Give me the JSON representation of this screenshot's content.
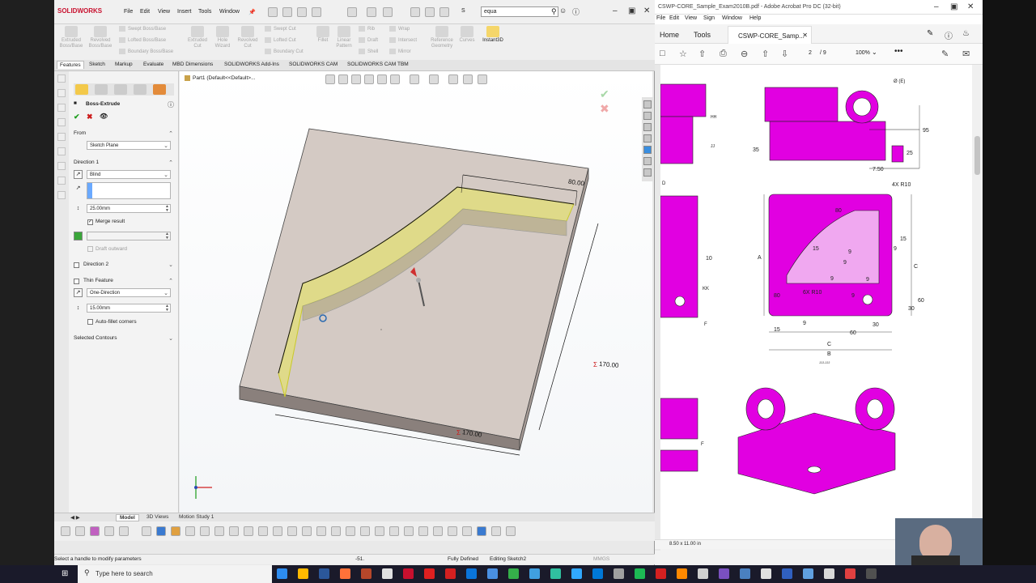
{
  "solidworks": {
    "logo": "SOLIDWORKS",
    "menu": [
      "File",
      "Edit",
      "View",
      "Insert",
      "Tools",
      "Window"
    ],
    "search_value": "equa",
    "search_label": "S",
    "ribbon": {
      "extruded_boss": "Extruded Boss/Base",
      "revolved_boss": "Revolved Boss/Base",
      "swept_boss": "Swept Boss/Base",
      "lofted_boss": "Lofted Boss/Base",
      "boundary_boss": "Boundary Boss/Base",
      "extruded_cut": "Extruded Cut",
      "hole_wizard": "Hole Wizard",
      "revolved_cut": "Revolved Cut",
      "swept_cut": "Swept Cut",
      "lofted_cut": "Lofted Cut",
      "boundary_cut": "Boundary Cut",
      "fillet": "Fillet",
      "linear_pattern": "Linear Pattern",
      "rib": "Rib",
      "draft": "Draft",
      "shell": "Shell",
      "wrap": "Wrap",
      "intersect": "Intersect",
      "mirror": "Mirror",
      "reference_geometry": "Reference Geometry",
      "curves": "Curves",
      "instant3d": "Instant3D"
    },
    "tabs": [
      "Features",
      "Sketch",
      "Markup",
      "Evaluate",
      "MBD Dimensions",
      "SOLIDWORKS Add-Ins",
      "SOLIDWORKS CAM",
      "SOLIDWORKS CAM TBM"
    ],
    "property_manager": {
      "title": "Boss-Extrude",
      "from_label": "From",
      "from_value": "Sketch Plane",
      "direction1_label": "Direction 1",
      "end_condition": "Blind",
      "depth": "25.00mm",
      "merge_result": "Merge result",
      "merge_checked": true,
      "draft_outward": "Draft outward",
      "direction2_label": "Direction 2",
      "thin_feature_label": "Thin Feature",
      "thin_type": "One-Direction",
      "thin_thickness": "15.00mm",
      "auto_fillet": "Auto-fillet corners",
      "selected_contours": "Selected Contours"
    },
    "breadcrumb": "Part1  (Default<<Default>...",
    "dimensions": {
      "top": "80.00",
      "right": "170.00",
      "bottom": "170.00"
    },
    "bottom_tabs": [
      "Model",
      "3D Views",
      "Motion Study 1"
    ],
    "status": {
      "hint": "Select a handle to modify parameters",
      "coord": "-51.",
      "defined": "Fully Defined",
      "editing": "Editing Sketch2",
      "units": "MMGS"
    }
  },
  "acrobat": {
    "title": "CSWP-CORE_Sample_Exam2010B.pdf - Adobe Acrobat Pro DC (32-bit)",
    "menu": [
      "File",
      "Edit",
      "View",
      "Sign",
      "Window",
      "Help"
    ],
    "tabs": [
      "Home",
      "Tools"
    ],
    "doc_tab": "CSWP-CORE_Samp...",
    "page_current": "2",
    "page_total": "/ 9",
    "zoom": "100%",
    "page_size": "8.50 x 11.00 in",
    "drawing_labels": {
      "phiE": "Ø (E)",
      "d95": "95",
      "d35": "35",
      "d25": "25",
      "d750": "7.50",
      "hh": "HH",
      "jj": "JJ",
      "d": "D",
      "r10": "4X R10",
      "d80a": "80",
      "d15a": "15",
      "d9a": "9",
      "d15b": "15",
      "d9b": "9",
      "dA": "A",
      "dC": "C",
      "d80b": "80",
      "d9c": "9",
      "d9d": "9",
      "d9e": "9",
      "r6x": "6X R10",
      "d9f": "9",
      "d60": "60",
      "d30a": "30",
      "d30b": "30",
      "d60b": "60",
      "d15c": "15",
      "d9g": "9",
      "dC2": "C",
      "dB": "B",
      "kk": "KK",
      "d10": "10",
      "f1": "F",
      "f2": "F",
      "jjjj": "JJJ-JJJ"
    }
  },
  "taskbar": {
    "search_placeholder": "Type here to search"
  },
  "colors": {
    "magenta": "#e100e1",
    "sw_red": "#c8102e",
    "selection_yellow": "#e8e85a"
  }
}
